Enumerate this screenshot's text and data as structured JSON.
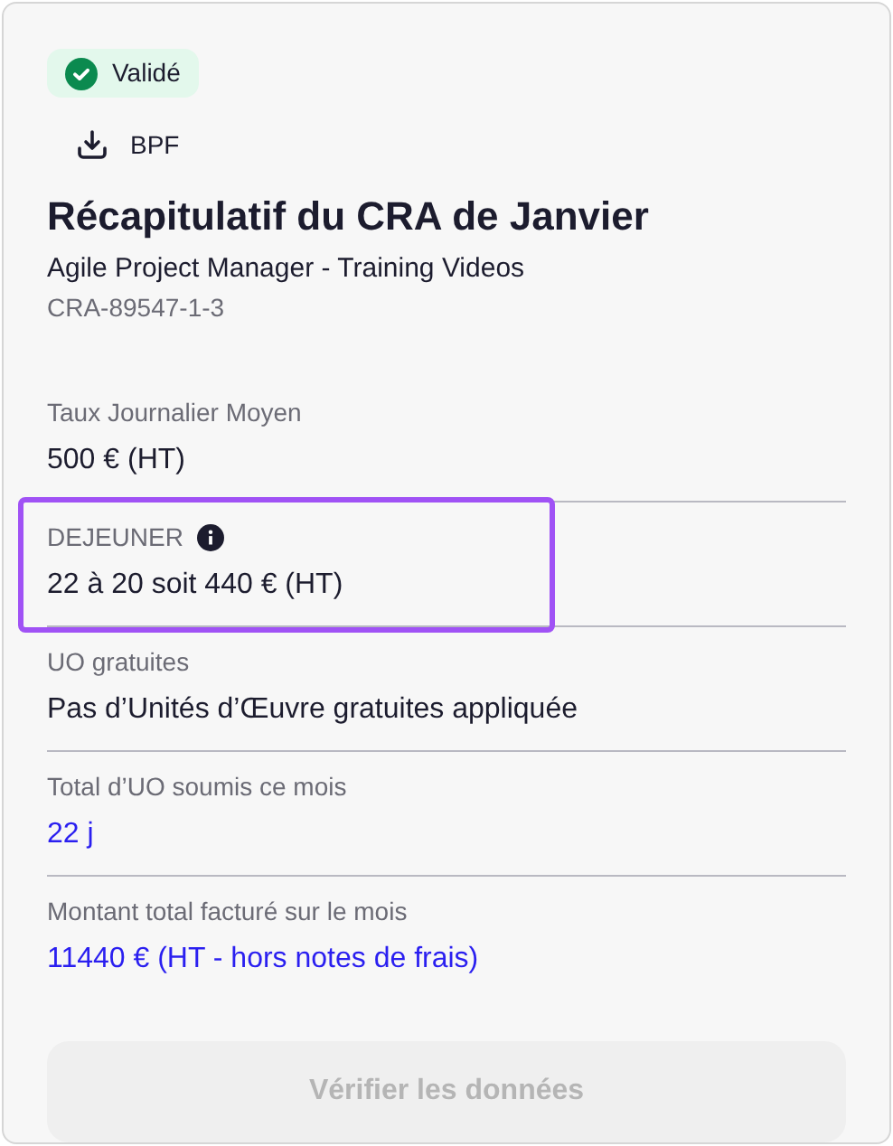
{
  "status_badge": {
    "label": "Validé",
    "validated": true
  },
  "download": {
    "label": "BPF"
  },
  "title": "Récapitulatif du CRA de Janvier",
  "subtitle": "Agile Project Manager - Training Videos",
  "reference": "CRA-89547-1-3",
  "fields": [
    {
      "label": "Taux Journalier Moyen",
      "value": "500 € (HT)",
      "highlighted": false,
      "info": false,
      "emphasized": false
    },
    {
      "label": "DEJEUNER",
      "value": "22 à 20 soit 440 € (HT)",
      "highlighted": true,
      "info": true,
      "emphasized": false
    },
    {
      "label": "UO gratuites",
      "value": "Pas d’Unités d’Œuvre gratuites appliquée",
      "highlighted": false,
      "info": false,
      "emphasized": false
    },
    {
      "label": "Total d’UO soumis ce mois",
      "value": "22 j",
      "highlighted": false,
      "info": false,
      "emphasized": true
    },
    {
      "label": "Montant total facturé sur le mois",
      "value": "11440 € (HT - hors notes de frais)",
      "highlighted": false,
      "info": false,
      "emphasized": true
    }
  ],
  "verify_button": {
    "label": "Vérifier les données",
    "disabled": true
  }
}
